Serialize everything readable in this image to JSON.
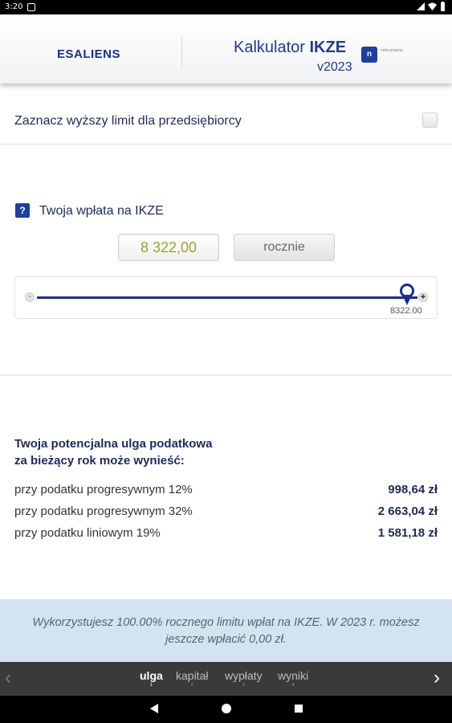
{
  "status_bar": {
    "time": "3:20"
  },
  "header": {
    "logo": "ESALIENS",
    "calc_title_prefix": "Kalkulator ",
    "calc_title_bold": "IKZE",
    "version": "v2023",
    "badge": "n",
    "badge_text": "nota prawna"
  },
  "entrepreneur": {
    "label": "Zaznacz wyższy limit dla przedsiębiorcy",
    "checked": false
  },
  "contribution": {
    "title": "Twoja wpłata na IKZE",
    "amount": "8 322,00",
    "period": "rocznie",
    "slider": {
      "value_label": "8322.00",
      "fraction": 1.0,
      "minus": "-",
      "plus": "+"
    }
  },
  "relief": {
    "title_line1": "Twoja potencjalna ulga podatkowa",
    "title_line2": "za bieżący rok może wynieść:",
    "rows": [
      {
        "label": "przy podatku progresywnym 12%",
        "value": "998,64 zł"
      },
      {
        "label": "przy podatku progresywnym 32%",
        "value": "2 663,04 zł"
      },
      {
        "label": "przy podatku liniowym 19%",
        "value": "1 581,18 zł"
      }
    ]
  },
  "info": {
    "text": "Wykorzystujesz 100.00% rocznego limitu wpłat na IKZE. W 2023 r. możesz jeszcze wpłacić 0,00 zł."
  },
  "nav": {
    "tabs": [
      {
        "label": "ulga",
        "num": "1",
        "active": true
      },
      {
        "label": "kapitał",
        "num": "2",
        "active": false
      },
      {
        "label": "wypłaty",
        "num": "3",
        "active": false
      },
      {
        "label": "wyniki",
        "num": "4",
        "active": false
      }
    ],
    "prev": "‹",
    "next": "›"
  },
  "colors": {
    "brand_blue": "#1b2f8c",
    "amount_green": "#9aa42c",
    "info_bg": "#d4e3f2",
    "nav_bg": "#3a3a3a"
  }
}
